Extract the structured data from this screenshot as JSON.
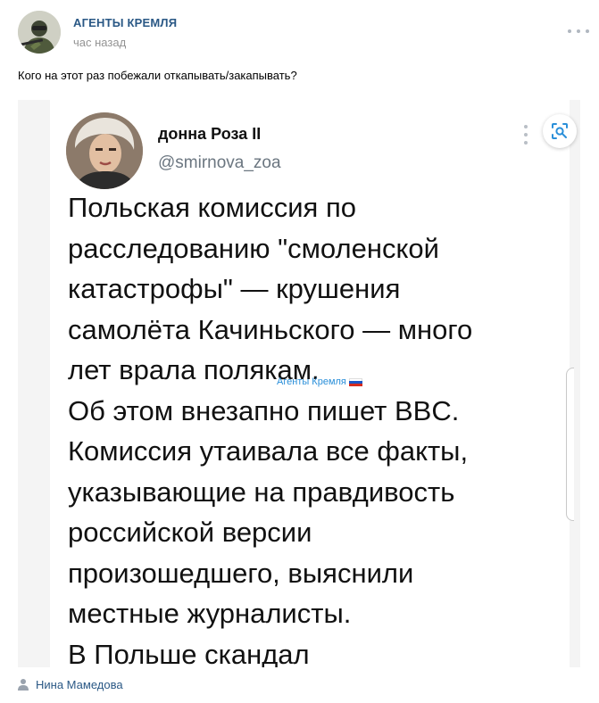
{
  "post": {
    "group_name": "АГЕНТЫ КРЕМЛЯ",
    "time": "час назад",
    "text": "Кого на этот раз побежали откапывать/закапывать?",
    "author": "Нина Мамедова"
  },
  "tweet": {
    "name": "донна Роза II",
    "handle": "@smirnova_zoa",
    "lines": [
      "Польская комиссия по",
      "расследованию \"смоленской",
      "катастрофы\" — крушения",
      "самолёта Качиньского — много",
      "лет врала полякам.",
      "Об этом внезапно пишет BBC.",
      "Комиссия утаивала все факты,",
      "указывающие на правдивость",
      "российской версии",
      "произошедшего, выяснили",
      "местные журналисты.",
      "В Польше скандал"
    ],
    "watermark": "Агенты Кремля"
  },
  "colors": {
    "link": "#2a5885",
    "muted": "#939393",
    "watermark": "#2a8fd9",
    "lens_accent": "#2a8fd9"
  },
  "icons": {
    "more": "more-horizontal-icon",
    "lens": "image-search-icon",
    "author": "user-icon",
    "flag": "russian-flag-icon"
  }
}
